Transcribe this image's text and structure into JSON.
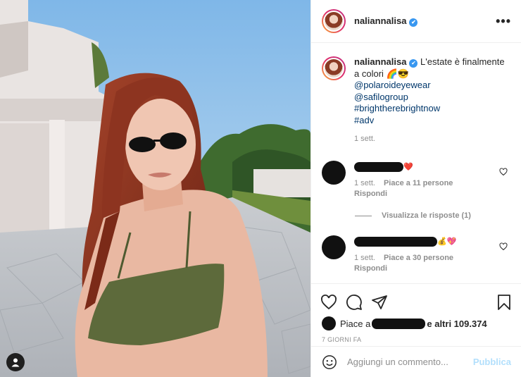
{
  "post": {
    "username": "naliannalisa",
    "verified_mark": "✔",
    "more_label": "•••",
    "caption": {
      "text": "L'estate è finalmente a colori 🌈😎",
      "tags": [
        "@polaroideyewear",
        "@safilogroup",
        "#brightherebrightnow",
        "#adv"
      ],
      "time": "1 sett."
    },
    "comments": [
      {
        "emoji": "❤️",
        "time": "1 sett.",
        "likes": "Piace a 11 persone",
        "reply": "Rispondi"
      },
      {
        "emoji": "💰💖",
        "time": "1 sett.",
        "likes": "Piace a 30 persone",
        "reply": "Rispondi"
      }
    ],
    "view_replies": "Visualizza le risposte (1)",
    "likes_prefix": "Piace a",
    "likes_suffix": "e altri 109.374",
    "date": "7 GIORNI FA",
    "comment_placeholder": "Aggiungi un commento...",
    "publish": "Pubblica"
  },
  "icons": [
    "heart-icon",
    "comment-icon",
    "share-icon",
    "bookmark-icon",
    "emoji-icon",
    "user-tag-icon",
    "more-icon"
  ],
  "colors": {
    "link": "#00376b",
    "secondary": "#8e8e8e",
    "publish_disabled": "#b2dffc",
    "verified": "#3897f0"
  }
}
